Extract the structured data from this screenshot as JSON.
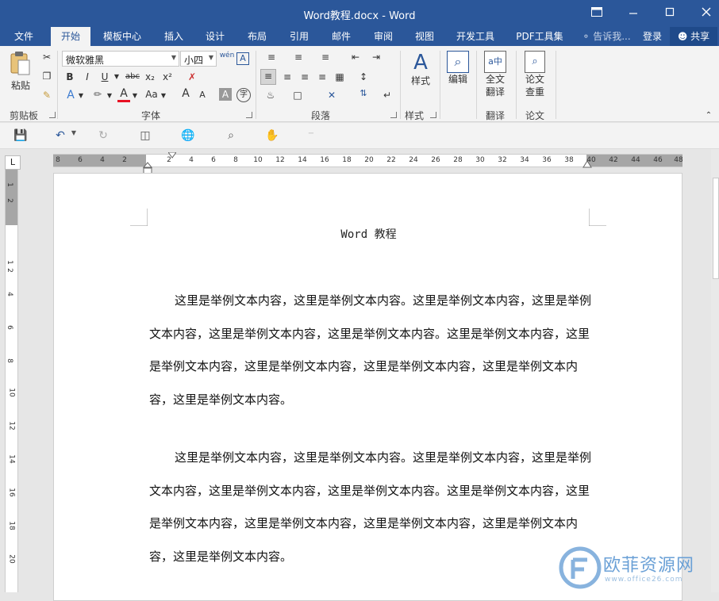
{
  "window": {
    "title": "Word教程.docx - Word",
    "restore_icon": "ribbon-display-icon",
    "controls": [
      "minimize",
      "maximize",
      "close"
    ]
  },
  "tabs": [
    {
      "label": "文件"
    },
    {
      "label": "开始",
      "active": true
    },
    {
      "label": "模板中心"
    },
    {
      "label": "插入"
    },
    {
      "label": "设计"
    },
    {
      "label": "布局"
    },
    {
      "label": "引用"
    },
    {
      "label": "邮件"
    },
    {
      "label": "审阅"
    },
    {
      "label": "视图"
    },
    {
      "label": "开发工具"
    },
    {
      "label": "PDF工具集"
    }
  ],
  "tellme": "告诉我...",
  "login": "登录",
  "share": "共享",
  "ribbon": {
    "clipboard": {
      "paste": "粘贴",
      "label": "剪贴板"
    },
    "font": {
      "name": "微软雅黑",
      "size": "小四",
      "wen": "wén",
      "A_box": "A",
      "bold": "B",
      "italic": "I",
      "underline": "U",
      "strike": "abc",
      "sub": "x₂",
      "sup": "x²",
      "font_color": "A",
      "change_case": "Aa",
      "grow": "A",
      "shrink": "A",
      "shade": "A",
      "enclose": "字",
      "label": "字体"
    },
    "paragraph": {
      "label": "段落"
    },
    "styles": {
      "btn": "样式",
      "label": "样式"
    },
    "editing": {
      "btn": "编辑"
    },
    "translate": {
      "btn_line1": "全文",
      "btn_line2": "翻译",
      "label": "翻译"
    },
    "paper": {
      "btn_line1": "论文",
      "btn_line2": "查重",
      "label": "论文"
    }
  },
  "ruler": {
    "corner": "L",
    "h_numbers": [
      "8",
      "6",
      "4",
      "2",
      "2",
      "4",
      "6",
      "8",
      "10",
      "12",
      "14",
      "16",
      "18",
      "20",
      "22",
      "24",
      "26",
      "28",
      "30",
      "32",
      "34",
      "36",
      "38",
      "40",
      "42",
      "44",
      "46",
      "48"
    ],
    "v_numbers": [
      "1",
      "2",
      "1",
      "2",
      "4",
      "6",
      "8",
      "10",
      "12",
      "14",
      "16",
      "18",
      "20"
    ]
  },
  "document": {
    "title": "Word 教程",
    "paragraphs": [
      "这里是举例文本内容，这里是举例文本内容。这里是举例文本内容，这里是举例文本内容，这里是举例文本内容，这里是举例文本内容。这里是举例文本内容，这里是举例文本内容，这里是举例文本内容，这里是举例文本内容，这里是举例文本内容，这里是举例文本内容。",
      "这里是举例文本内容，这里是举例文本内容。这里是举例文本内容，这里是举例文本内容，这里是举例文本内容，这里是举例文本内容。这里是举例文本内容，这里是举例文本内容，这里是举例文本内容，这里是举例文本内容，这里是举例文本内容，这里是举例文本内容。"
    ]
  },
  "watermark": {
    "text": "欧菲资源网",
    "url": "www.office26.com"
  },
  "colors": {
    "accent": "#2b579a",
    "ribbon": "#f3f3f3",
    "red": "#e81123"
  }
}
